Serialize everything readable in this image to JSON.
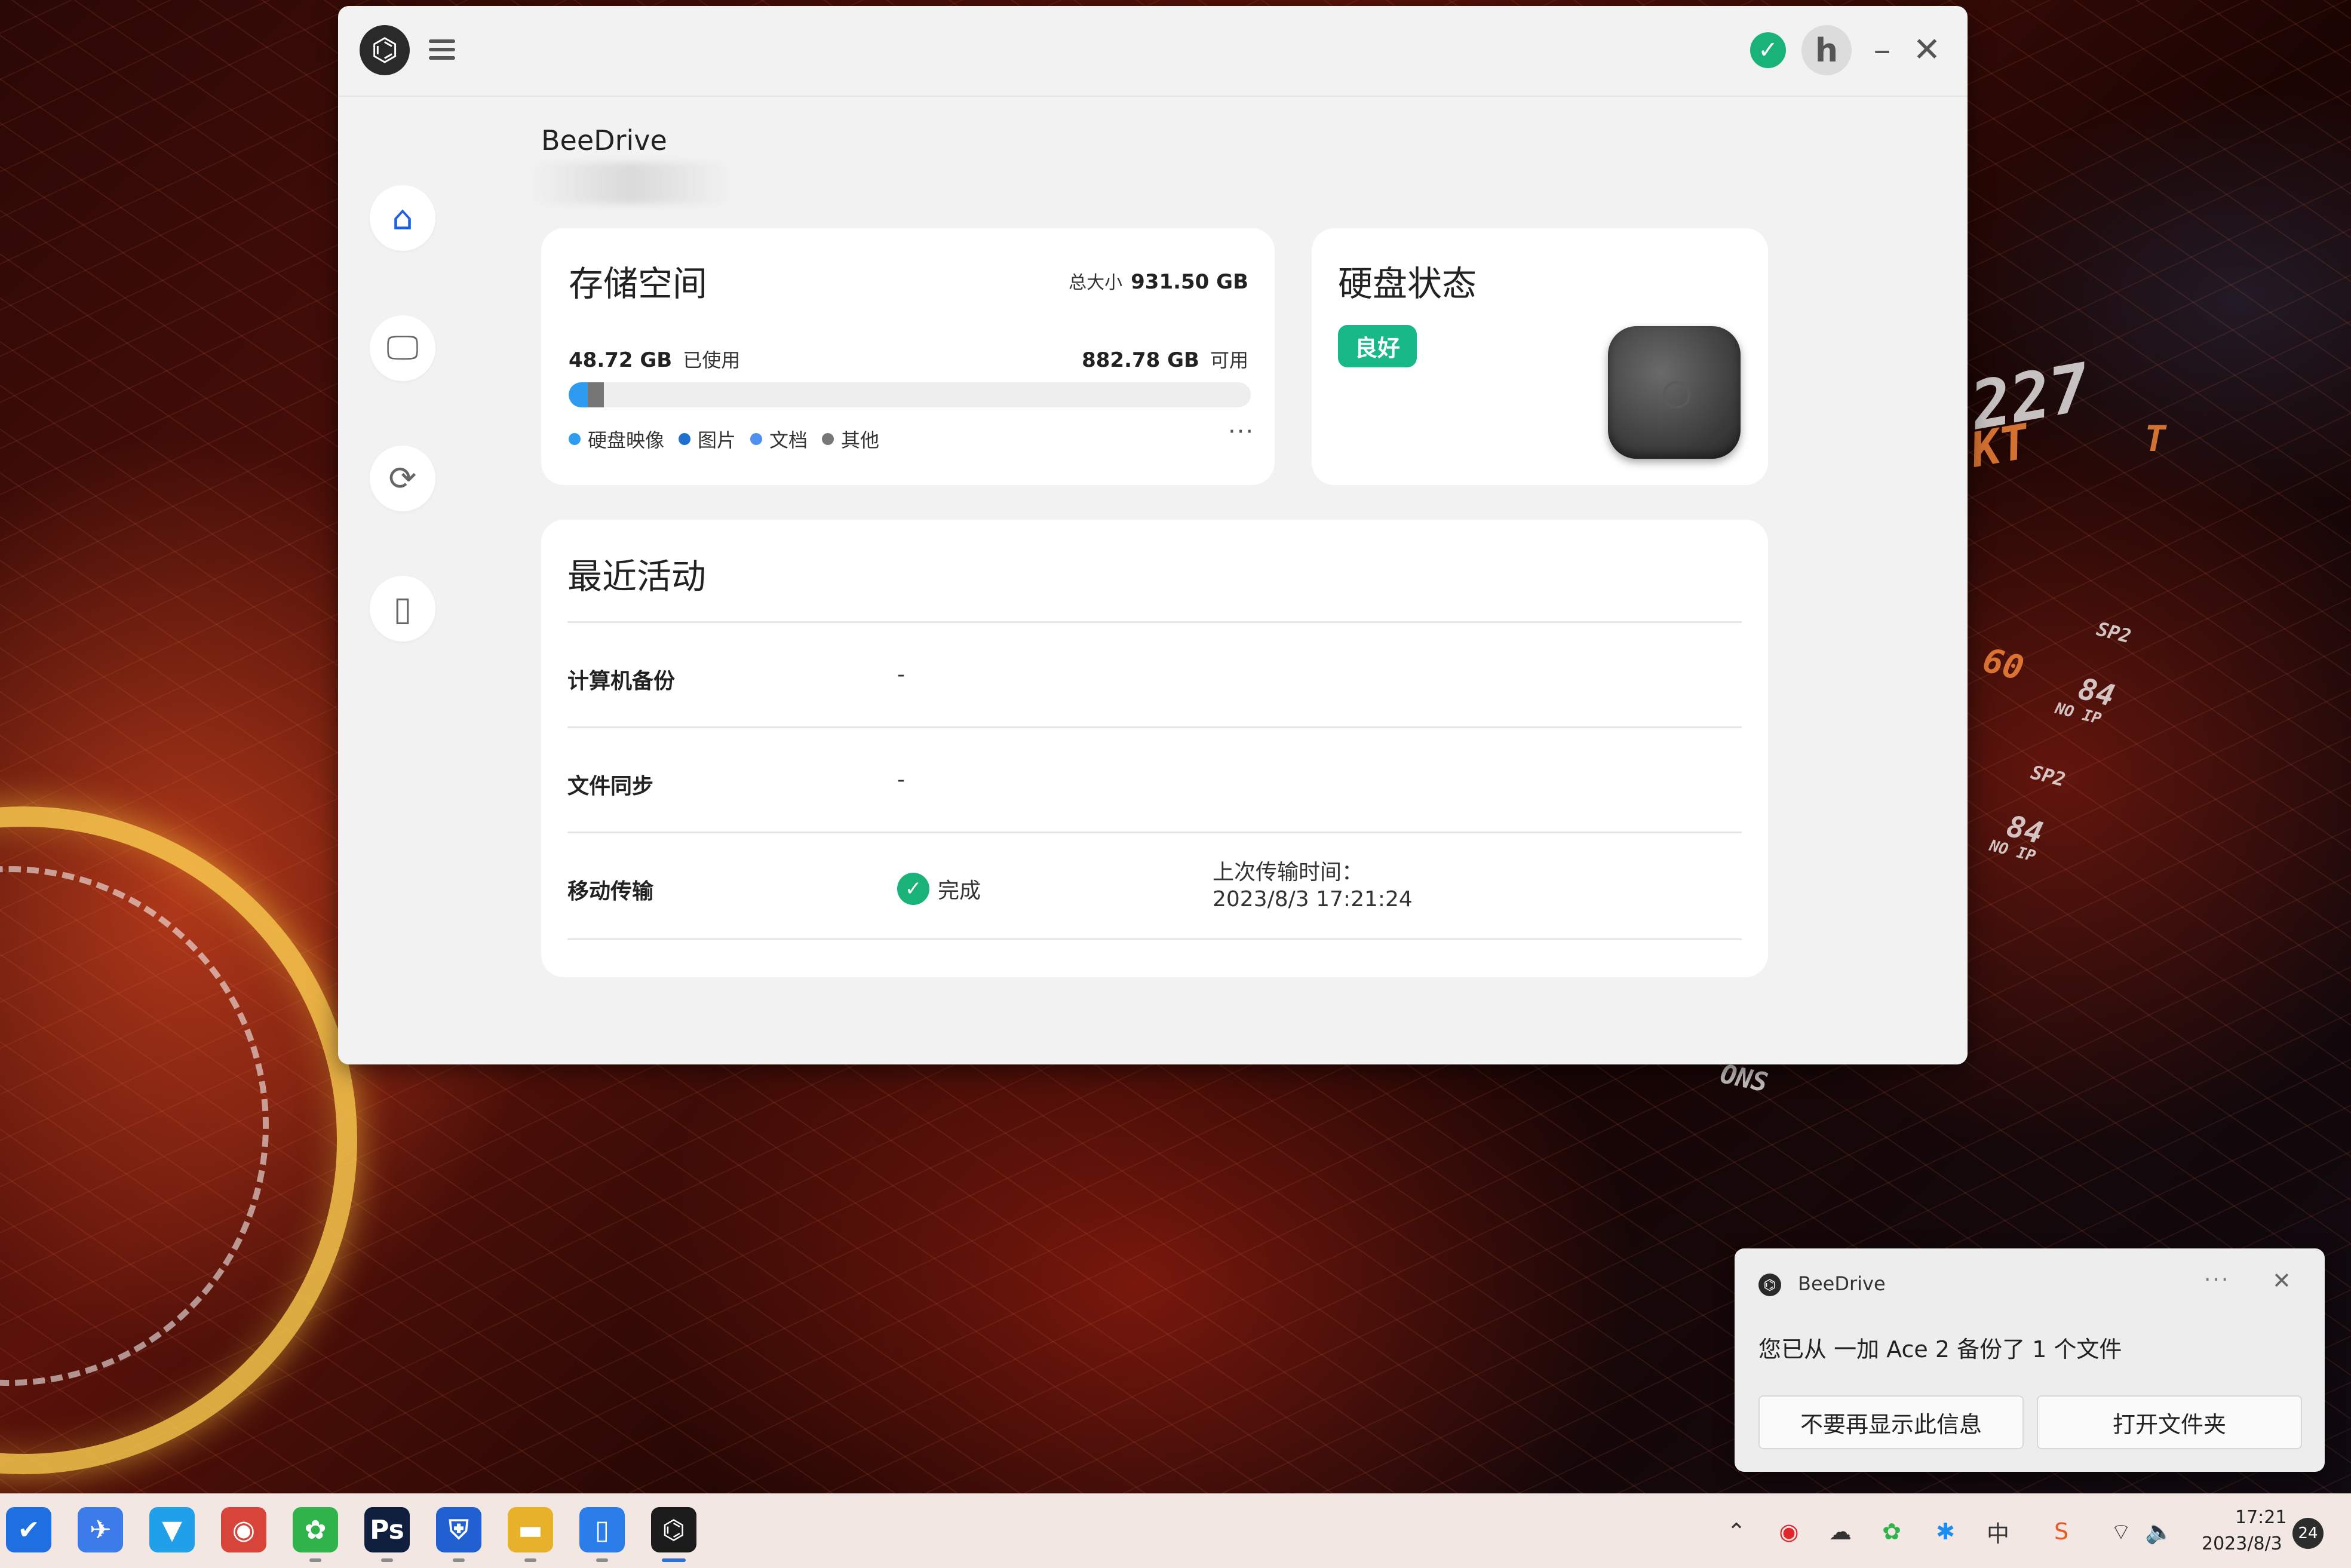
{
  "window": {
    "device_name": "BeeDrive"
  },
  "storage": {
    "title": "存储空间",
    "total_label": "总大小",
    "total_value": "931.50 GB",
    "used_value": "48.72 GB",
    "used_label": "已使用",
    "free_value": "882.78 GB",
    "free_label": "可用",
    "used_fraction": 0.052,
    "legend": [
      {
        "label": "硬盘映像",
        "color": "#2d9cf0"
      },
      {
        "label": "图片",
        "color": "#1f6fd1"
      },
      {
        "label": "文档",
        "color": "#4f8ff0"
      },
      {
        "label": "其他",
        "color": "#777777"
      }
    ],
    "more": "···"
  },
  "disk_status": {
    "title": "硬盘状态",
    "badge": "良好"
  },
  "activity": {
    "title": "最近活动",
    "rows": [
      {
        "label": "计算机备份",
        "value": "-"
      },
      {
        "label": "文件同步",
        "value": "-"
      },
      {
        "label": "移动传输",
        "value": "完成",
        "time_label": "上次传输时间：",
        "time_value": "2023/8/3 17:21:24"
      }
    ]
  },
  "toast": {
    "app": "BeeDrive",
    "more": "···",
    "close": "✕",
    "message": "您已从 一加 Ace 2 备份了 1 个文件",
    "btn_dismiss": "不要再显示此信息",
    "btn_open": "打开文件夹"
  },
  "taskbar": {
    "apps": [
      {
        "label": "✔",
        "color": "#1e6fe0"
      },
      {
        "label": "✈",
        "color": "#3b7bea"
      },
      {
        "label": "▼",
        "color": "#1fa0e8"
      },
      {
        "label": "◉",
        "color": "#d9443a"
      },
      {
        "label": "✿",
        "color": "#2fb34a"
      },
      {
        "label": "Ps",
        "color": "#0f1f3d"
      },
      {
        "label": "⛨",
        "color": "#2060d0"
      },
      {
        "label": "▬",
        "color": "#e8b12a"
      },
      {
        "label": "▯",
        "color": "#2b7de9"
      },
      {
        "label": "⌬",
        "color": "#1c1c1c"
      }
    ],
    "time": "17:21",
    "date": "2023/8/3",
    "notif_count": "24"
  },
  "hud": {
    "t1": "227",
    "t2": "KT",
    "t3": "T",
    "t4": "SP2",
    "t5": "60",
    "t6": "84",
    "t7": "NO IP",
    "t8": "SP2",
    "t9": "84",
    "t10": "NO IP",
    "t11": "ONS"
  },
  "colors": {
    "accent": "#2d9cf0",
    "ok": "#19b37a",
    "badge": "#18b889"
  }
}
